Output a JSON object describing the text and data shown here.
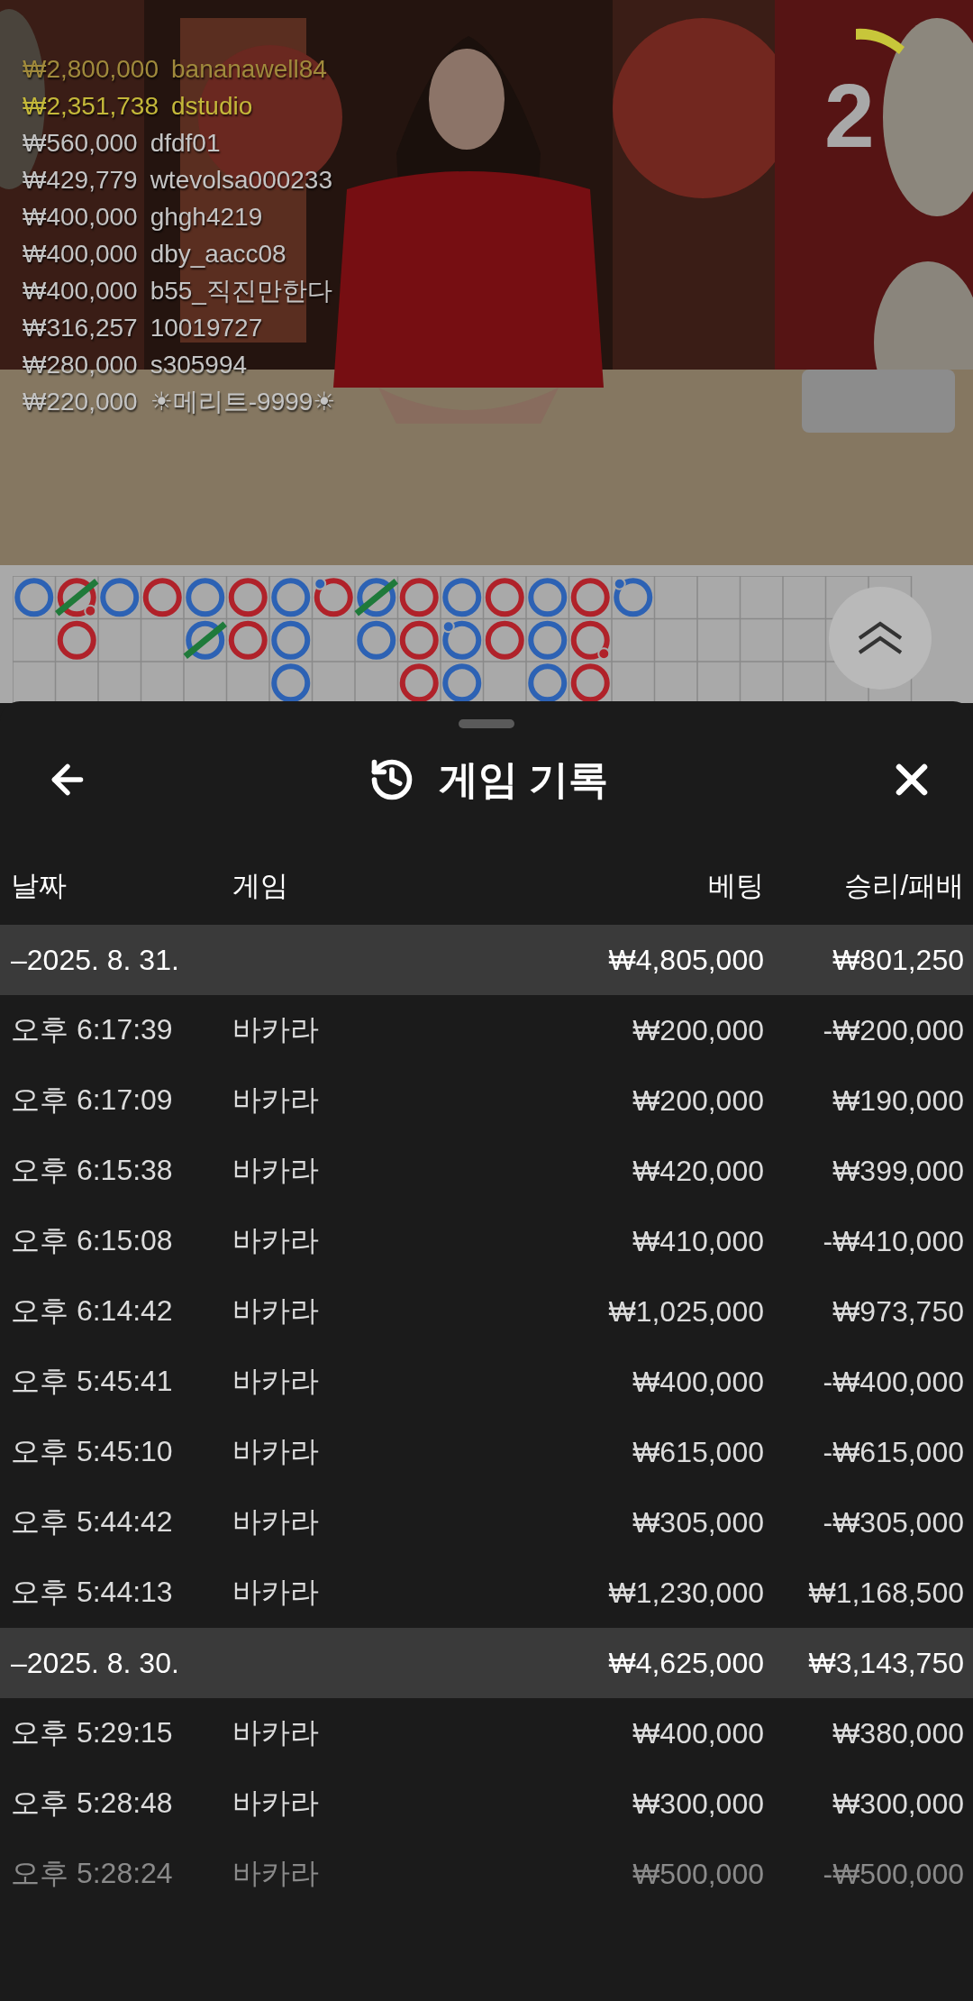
{
  "leaderboard": [
    {
      "amount": "₩2,800,000",
      "name": "bananawell84",
      "color": "#a08a3c"
    },
    {
      "amount": "₩2,351,738",
      "name": "dstudio",
      "color": "#c4b83a"
    },
    {
      "amount": "₩560,000",
      "name": "dfdf01",
      "color": "#c4c4c4"
    },
    {
      "amount": "₩429,779",
      "name": "wtevolsa000233",
      "color": "#c4c4c4"
    },
    {
      "amount": "₩400,000",
      "name": "ghgh4219",
      "color": "#c4c4c4"
    },
    {
      "amount": "₩400,000",
      "name": "dby_aacc08",
      "color": "#c4c4c4"
    },
    {
      "amount": "₩400,000",
      "name": "b55_직진만한다",
      "color": "#c4c4c4"
    },
    {
      "amount": "₩316,257",
      "name": "10019727",
      "color": "#c4c4c4"
    },
    {
      "amount": "₩280,000",
      "name": "s305994",
      "color": "#c4c4c4"
    },
    {
      "amount": "₩220,000",
      "name": "☀메리트-9999☀",
      "color": "#c4c4c4"
    }
  ],
  "timer": "2",
  "road": {
    "columns": [
      [
        {
          "kind": "player",
          "tie": false,
          "player_pair": false,
          "banker_pair": false
        }
      ],
      [
        {
          "kind": "banker",
          "tie": true,
          "player_pair": false,
          "banker_pair": true
        },
        {
          "kind": "banker",
          "tie": false,
          "player_pair": false,
          "banker_pair": false
        }
      ],
      [
        {
          "kind": "player",
          "tie": false,
          "player_pair": false,
          "banker_pair": false
        }
      ],
      [
        {
          "kind": "banker",
          "tie": false,
          "player_pair": false,
          "banker_pair": false
        }
      ],
      [
        {
          "kind": "player",
          "tie": false,
          "player_pair": false,
          "banker_pair": false
        },
        {
          "kind": "player",
          "tie": true,
          "player_pair": false,
          "banker_pair": false
        }
      ],
      [
        {
          "kind": "banker",
          "tie": false,
          "player_pair": false,
          "banker_pair": false
        },
        {
          "kind": "banker",
          "tie": false,
          "player_pair": false,
          "banker_pair": false
        }
      ],
      [
        {
          "kind": "player",
          "tie": false,
          "player_pair": false,
          "banker_pair": false
        },
        {
          "kind": "player",
          "tie": false,
          "player_pair": false,
          "banker_pair": false
        },
        {
          "kind": "player",
          "tie": false,
          "player_pair": false,
          "banker_pair": false
        }
      ],
      [
        {
          "kind": "banker",
          "tie": false,
          "player_pair": true,
          "banker_pair": false
        }
      ],
      [
        {
          "kind": "player",
          "tie": true,
          "player_pair": false,
          "banker_pair": false
        },
        {
          "kind": "player",
          "tie": false,
          "player_pair": false,
          "banker_pair": false
        }
      ],
      [
        {
          "kind": "banker",
          "tie": false,
          "player_pair": false,
          "banker_pair": false
        },
        {
          "kind": "banker",
          "tie": false,
          "player_pair": false,
          "banker_pair": false
        },
        {
          "kind": "banker",
          "tie": false,
          "player_pair": false,
          "banker_pair": false
        }
      ],
      [
        {
          "kind": "player",
          "tie": false,
          "player_pair": false,
          "banker_pair": false
        },
        {
          "kind": "player",
          "tie": false,
          "player_pair": true,
          "banker_pair": false
        },
        {
          "kind": "player",
          "tie": false,
          "player_pair": false,
          "banker_pair": false
        }
      ],
      [
        {
          "kind": "banker",
          "tie": false,
          "player_pair": false,
          "banker_pair": false
        },
        {
          "kind": "banker",
          "tie": false,
          "player_pair": false,
          "banker_pair": false
        }
      ],
      [
        {
          "kind": "player",
          "tie": false,
          "player_pair": false,
          "banker_pair": false
        },
        {
          "kind": "player",
          "tie": false,
          "player_pair": false,
          "banker_pair": false
        },
        {
          "kind": "player",
          "tie": false,
          "player_pair": false,
          "banker_pair": false
        }
      ],
      [
        {
          "kind": "banker",
          "tie": false,
          "player_pair": false,
          "banker_pair": false
        },
        {
          "kind": "banker",
          "tie": false,
          "player_pair": false,
          "banker_pair": true
        },
        {
          "kind": "banker",
          "tie": false,
          "player_pair": false,
          "banker_pair": false
        }
      ],
      [
        {
          "kind": "player",
          "tie": false,
          "player_pair": true,
          "banker_pair": false
        }
      ]
    ]
  },
  "sheet": {
    "title": "게임 기록",
    "columns": [
      "날짜",
      "게임",
      "베팅",
      "승리/패배"
    ],
    "groups": [
      {
        "date": "–2025. 8. 31.",
        "bet": "₩4,805,000",
        "result": "₩801,250",
        "rows": [
          {
            "time": "오후 6:17:39",
            "game": "바카라",
            "bet": "₩200,000",
            "result": "-₩200,000",
            "dimmed": false
          },
          {
            "time": "오후 6:17:09",
            "game": "바카라",
            "bet": "₩200,000",
            "result": "₩190,000",
            "dimmed": false
          },
          {
            "time": "오후 6:15:38",
            "game": "바카라",
            "bet": "₩420,000",
            "result": "₩399,000",
            "dimmed": false
          },
          {
            "time": "오후 6:15:08",
            "game": "바카라",
            "bet": "₩410,000",
            "result": "-₩410,000",
            "dimmed": false
          },
          {
            "time": "오후 6:14:42",
            "game": "바카라",
            "bet": "₩1,025,000",
            "result": "₩973,750",
            "dimmed": false
          },
          {
            "time": "오후 5:45:41",
            "game": "바카라",
            "bet": "₩400,000",
            "result": "-₩400,000",
            "dimmed": false
          },
          {
            "time": "오후 5:45:10",
            "game": "바카라",
            "bet": "₩615,000",
            "result": "-₩615,000",
            "dimmed": false
          },
          {
            "time": "오후 5:44:42",
            "game": "바카라",
            "bet": "₩305,000",
            "result": "-₩305,000",
            "dimmed": false
          },
          {
            "time": "오후 5:44:13",
            "game": "바카라",
            "bet": "₩1,230,000",
            "result": "₩1,168,500",
            "dimmed": false
          }
        ]
      },
      {
        "date": "–2025. 8. 30.",
        "bet": "₩4,625,000",
        "result": "₩3,143,750",
        "rows": [
          {
            "time": "오후 5:29:15",
            "game": "바카라",
            "bet": "₩400,000",
            "result": "₩380,000",
            "dimmed": false
          },
          {
            "time": "오후 5:28:48",
            "game": "바카라",
            "bet": "₩300,000",
            "result": "₩300,000",
            "dimmed": false
          },
          {
            "time": "오후 5:28:24",
            "game": "바카라",
            "bet": "₩500,000",
            "result": "-₩500,000",
            "dimmed": true
          }
        ]
      }
    ]
  }
}
